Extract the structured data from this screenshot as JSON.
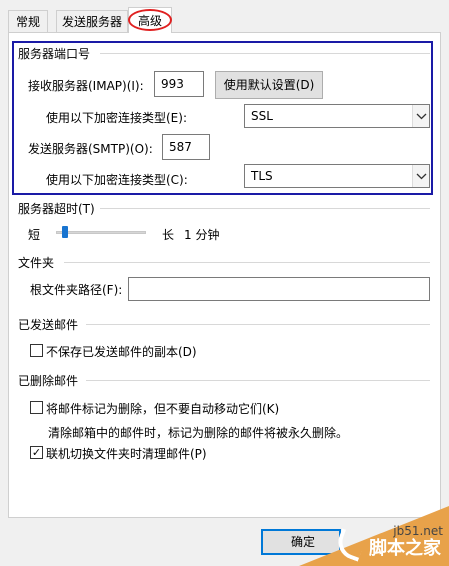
{
  "tabs": [
    {
      "label": "常规",
      "active": false
    },
    {
      "label": "发送服务器",
      "active": false
    },
    {
      "label": "高级",
      "active": true
    }
  ],
  "server_ports": {
    "heading": "服务器端口号",
    "incoming_label": "接收服务器(IMAP)(I):",
    "incoming_value": "993",
    "default_button": "使用默认设置(D)",
    "incoming_encryption_label": "使用以下加密连接类型(E):",
    "incoming_encryption_value": "SSL",
    "outgoing_label": "发送服务器(SMTP)(O):",
    "outgoing_value": "587",
    "outgoing_encryption_label": "使用以下加密连接类型(C):",
    "outgoing_encryption_value": "TLS"
  },
  "timeout": {
    "heading": "服务器超时(T)",
    "short_label": "短",
    "long_label": "长",
    "value_text": "1 分钟",
    "slider_level": 0.1
  },
  "folders": {
    "heading": "文件夹",
    "root_path_label": "根文件夹路径(F):",
    "root_path_value": ""
  },
  "sent_items": {
    "heading": "已发送邮件",
    "no_copy_label": "不保存已发送邮件的副本(D)",
    "no_copy_checked": false
  },
  "deleted_items": {
    "heading": "已删除邮件",
    "mark_label": "将邮件标记为删除，但不要自动移动它们(K)",
    "mark_checked": false,
    "mark_note": "清除邮箱中的邮件时，标记为删除的邮件将被永久删除。",
    "purge_label": "联机切换文件夹时清理邮件(P)",
    "purge_checked": true,
    "checked_glyph": "✓"
  },
  "footer": {
    "ok_label": "确定"
  },
  "watermark": {
    "site": "jb51.net",
    "name": "脚本之家"
  },
  "colors": {
    "highlight_box": "#1a1aa6",
    "tab_circle": "#e02020",
    "slider_thumb": "#1874d0",
    "watermark": "#e8a24a"
  }
}
